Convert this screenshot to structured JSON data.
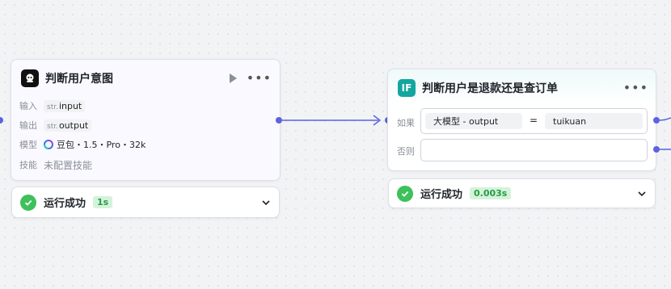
{
  "colors": {
    "accent": "#5b63e0",
    "success": "#3ec05a",
    "if_icon": "#13a6a0"
  },
  "intent_node": {
    "icon": "llm-robot-icon",
    "title": "判断用户意图",
    "input_label": "输入",
    "input_type": "str.",
    "input_name": "input",
    "output_label": "输出",
    "output_type": "str.",
    "output_name": "output",
    "model_label": "模型",
    "model_icon": "doubao-model-icon",
    "model_value": "豆包・1.5・Pro・32k",
    "skill_label": "技能",
    "skill_value": "未配置技能"
  },
  "intent_status": {
    "text": "运行成功",
    "time": "1s"
  },
  "if_node": {
    "icon_text": "IF",
    "title": "判断用户是退款还是查订单",
    "if_label": "如果",
    "cond_left": "大模型  -  output",
    "cond_op": "=",
    "cond_right": "tuikuan",
    "else_label": "否则"
  },
  "if_status": {
    "text": "运行成功",
    "time": "0.003s"
  }
}
